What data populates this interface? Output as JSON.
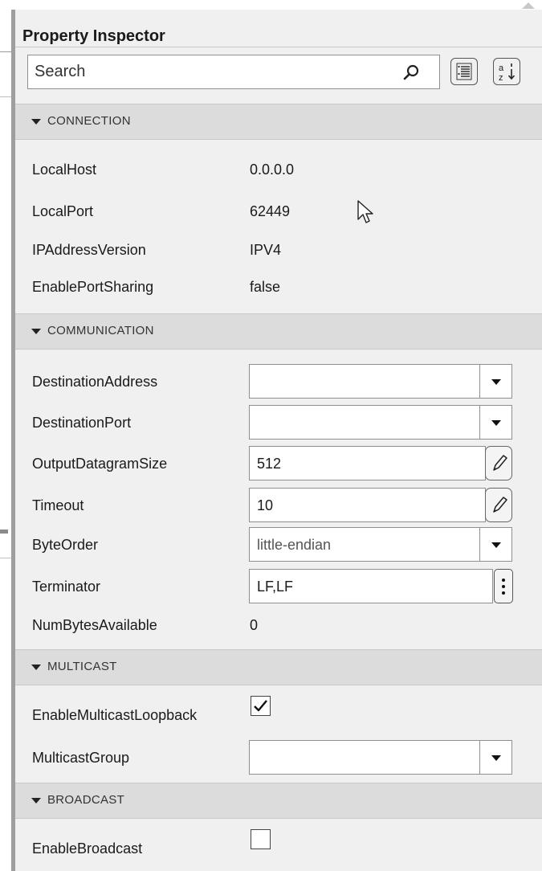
{
  "window": {
    "title": "Property Inspector"
  },
  "toolbar": {
    "search_placeholder": "Search",
    "categorized_icon": "list-categorized-icon",
    "alphabetical_icon": "sort-alphabetical-icon"
  },
  "sections": {
    "connection": {
      "title": "CONNECTION",
      "props": [
        {
          "label": "LocalHost",
          "value": "0.0.0.0"
        },
        {
          "label": "LocalPort",
          "value": "62449"
        },
        {
          "label": "IPAddressVersion",
          "value": "IPV4"
        },
        {
          "label": "EnablePortSharing",
          "value": "false"
        }
      ]
    },
    "communication": {
      "title": "COMMUNICATION",
      "props": [
        {
          "label": "DestinationAddress",
          "value": ""
        },
        {
          "label": "DestinationPort",
          "value": ""
        },
        {
          "label": "OutputDatagramSize",
          "value": "512"
        },
        {
          "label": "Timeout",
          "value": "10"
        },
        {
          "label": "ByteOrder",
          "value": "little-endian"
        },
        {
          "label": "Terminator",
          "value": "LF,LF"
        },
        {
          "label": "NumBytesAvailable",
          "value": "0"
        }
      ]
    },
    "multicast": {
      "title": "MULTICAST",
      "props": [
        {
          "label": "EnableMulticastLoopback",
          "checked": true
        },
        {
          "label": "MulticastGroup",
          "value": ""
        }
      ]
    },
    "broadcast": {
      "title": "BROADCAST",
      "props": [
        {
          "label": "EnableBroadcast",
          "checked": false
        }
      ]
    }
  }
}
